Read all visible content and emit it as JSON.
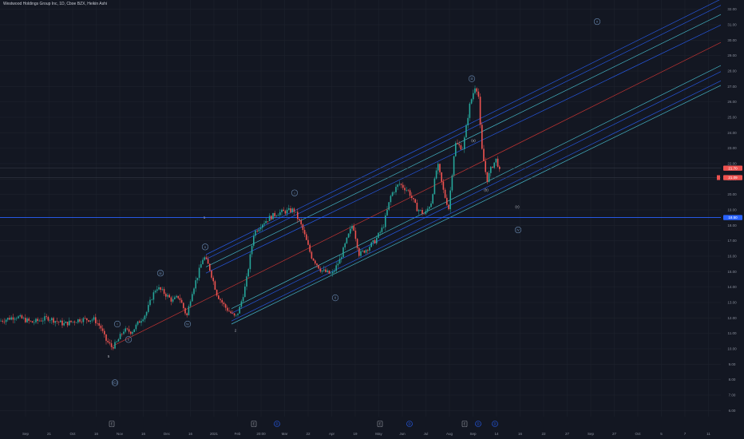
{
  "header": {
    "title": "Westwood Holdings Group Inc, 1D, Cboe BZX, Heikin Ashi"
  },
  "colors": {
    "background": "#131722",
    "up": "#26a69a",
    "down": "#ef5350",
    "channel_blue": "#2962ff",
    "channel_cyan": "#4dd0e1",
    "channel_red": "#e53935",
    "hline": "#2962ff",
    "grid": "#1e222d",
    "axis_text": "#8a8f9c",
    "wave_circle": "#6d8fb8"
  },
  "chart_data": {
    "type": "candlestick",
    "x_ticks": [
      "Sep",
      "21",
      "Oct",
      "16",
      "Nov",
      "16",
      "Dec",
      "16",
      "2021",
      "Feb",
      "20:00",
      "Mar",
      "22",
      "Apr",
      "19",
      "May",
      "Jun",
      "Jul",
      "Aug",
      "Sep",
      "14",
      "16",
      "22",
      "27",
      "Sep",
      "27",
      "Oct",
      "5",
      "7",
      "11"
    ],
    "y_ticks": [
      "32.00",
      "31.00",
      "30.00",
      "29.00",
      "28.00",
      "27.00",
      "26.00",
      "25.00",
      "24.00",
      "23.00",
      "22.00",
      "21.00",
      "20.00",
      "19.00",
      "18.00",
      "17.00",
      "16.00",
      "15.00",
      "14.00",
      "13.00",
      "12.00",
      "11.00",
      "10.00",
      "9.00",
      "8.00",
      "7.00",
      "6.00"
    ],
    "ylim": [
      5.6,
      32.6
    ],
    "price_labels": [
      {
        "value": 21.7,
        "text": "21.70",
        "color": "#ef5350"
      },
      {
        "value": 21.09,
        "text": "21.09",
        "color": "#ef5350"
      },
      {
        "value": 18.5,
        "text": "18.50",
        "color": "#2962ff"
      }
    ],
    "hline_value": 18.5,
    "price_series": [
      [
        0,
        11.8
      ],
      [
        20,
        12.1
      ],
      [
        40,
        11.7
      ],
      [
        60,
        12.0
      ],
      [
        80,
        11.6
      ],
      [
        100,
        11.9
      ],
      [
        118,
        11.9
      ],
      [
        126,
        11.4
      ],
      [
        132,
        10.6
      ],
      [
        140,
        10.1
      ],
      [
        145,
        10.3
      ],
      [
        155,
        11.2
      ],
      [
        165,
        11.1
      ],
      [
        175,
        11.8
      ],
      [
        183,
        12.3
      ],
      [
        190,
        13.3
      ],
      [
        196,
        14.0
      ],
      [
        206,
        13.6
      ],
      [
        216,
        13.1
      ],
      [
        224,
        13.4
      ],
      [
        234,
        12.1
      ],
      [
        240,
        13.6
      ],
      [
        248,
        14.8
      ],
      [
        255,
        16.0
      ],
      [
        262,
        15.3
      ],
      [
        272,
        13.5
      ],
      [
        282,
        12.7
      ],
      [
        295,
        12.0
      ],
      [
        300,
        12.6
      ],
      [
        308,
        14.2
      ],
      [
        318,
        17.5
      ],
      [
        328,
        18.1
      ],
      [
        338,
        18.5
      ],
      [
        348,
        18.8
      ],
      [
        358,
        18.9
      ],
      [
        368,
        19.0
      ],
      [
        378,
        17.9
      ],
      [
        390,
        16.0
      ],
      [
        402,
        15.1
      ],
      [
        416,
        14.8
      ],
      [
        426,
        15.8
      ],
      [
        434,
        17.0
      ],
      [
        442,
        18.1
      ],
      [
        450,
        16.1
      ],
      [
        460,
        16.5
      ],
      [
        470,
        17.0
      ],
      [
        480,
        17.9
      ],
      [
        490,
        20.0
      ],
      [
        500,
        20.7
      ],
      [
        512,
        20.2
      ],
      [
        522,
        19.1
      ],
      [
        532,
        18.7
      ],
      [
        540,
        19.5
      ],
      [
        548,
        22.0
      ],
      [
        556,
        20.1
      ],
      [
        562,
        19.1
      ],
      [
        570,
        23.3
      ],
      [
        580,
        23.0
      ],
      [
        588,
        25.7
      ],
      [
        595,
        27.0
      ],
      [
        599,
        26.7
      ],
      [
        603,
        23.1
      ],
      [
        610,
        20.9
      ],
      [
        616,
        21.8
      ],
      [
        622,
        22.3
      ],
      [
        628,
        21.0
      ]
    ],
    "channel_lines": [
      {
        "color": "blue",
        "x": [
          258,
          932
        ],
        "y": [
          16.1,
          33.4
        ]
      },
      {
        "color": "blue",
        "x": [
          258,
          932
        ],
        "y": [
          15.8,
          33.0
        ]
      },
      {
        "color": "cyan",
        "x": [
          258,
          932
        ],
        "y": [
          15.3,
          32.4
        ]
      },
      {
        "color": "blue",
        "x": [
          258,
          932
        ],
        "y": [
          14.9,
          31.7
        ]
      },
      {
        "color": "red",
        "x": [
          142,
          932
        ],
        "y": [
          10.2,
          30.6
        ]
      },
      {
        "color": "cyan",
        "x": [
          290,
          932
        ],
        "y": [
          12.6,
          29.1
        ]
      },
      {
        "color": "blue",
        "x": [
          290,
          932
        ],
        "y": [
          12.3,
          28.7
        ]
      },
      {
        "color": "blue",
        "x": [
          290,
          932
        ],
        "y": [
          11.8,
          28.1
        ]
      },
      {
        "color": "cyan",
        "x": [
          290,
          932
        ],
        "y": [
          11.6,
          27.8
        ]
      }
    ],
    "wave_labels": [
      {
        "text": "5",
        "x": 136,
        "y": 9.5,
        "circle": false
      },
      {
        "text": "(C)",
        "x": 144,
        "y": 7.8,
        "circle": true
      },
      {
        "text": "i",
        "x": 147,
        "y": 11.6,
        "circle": true
      },
      {
        "text": "ii",
        "x": 161,
        "y": 10.6,
        "circle": true
      },
      {
        "text": "iii",
        "x": 201,
        "y": 14.9,
        "circle": true
      },
      {
        "text": "iv",
        "x": 235,
        "y": 11.6,
        "circle": true
      },
      {
        "text": "v",
        "x": 257,
        "y": 16.6,
        "circle": true
      },
      {
        "text": "1",
        "x": 256,
        "y": 18.5,
        "circle": false
      },
      {
        "text": "2",
        "x": 295,
        "y": 11.2,
        "circle": false
      },
      {
        "text": "i",
        "x": 369,
        "y": 20.1,
        "circle": true
      },
      {
        "text": "ii",
        "x": 420,
        "y": 13.3,
        "circle": true
      },
      {
        "text": "iii",
        "x": 591,
        "y": 27.5,
        "circle": true
      },
      {
        "text": "(a)",
        "x": 593,
        "y": 23.5,
        "circle": false
      },
      {
        "text": "(b)",
        "x": 609,
        "y": 20.3,
        "circle": false
      },
      {
        "text": "(c)",
        "x": 648,
        "y": 19.2,
        "circle": false
      },
      {
        "text": "iv",
        "x": 649,
        "y": 17.7,
        "circle": true
      },
      {
        "text": "v",
        "x": 748,
        "y": 31.2,
        "circle": true
      }
    ],
    "event_markers": [
      {
        "text": "E",
        "x": 140,
        "color": "#9598a1"
      },
      {
        "text": "E",
        "x": 318,
        "color": "#9598a1"
      },
      {
        "text": "D",
        "x": 347,
        "color": "#2962ff"
      },
      {
        "text": "E",
        "x": 476,
        "color": "#9598a1"
      },
      {
        "text": "D",
        "x": 513,
        "color": "#2962ff"
      },
      {
        "text": "E",
        "x": 582,
        "color": "#9598a1"
      },
      {
        "text": "D",
        "x": 599,
        "color": "#2962ff"
      },
      {
        "text": "D",
        "x": 620,
        "color": "#2962ff"
      }
    ]
  }
}
